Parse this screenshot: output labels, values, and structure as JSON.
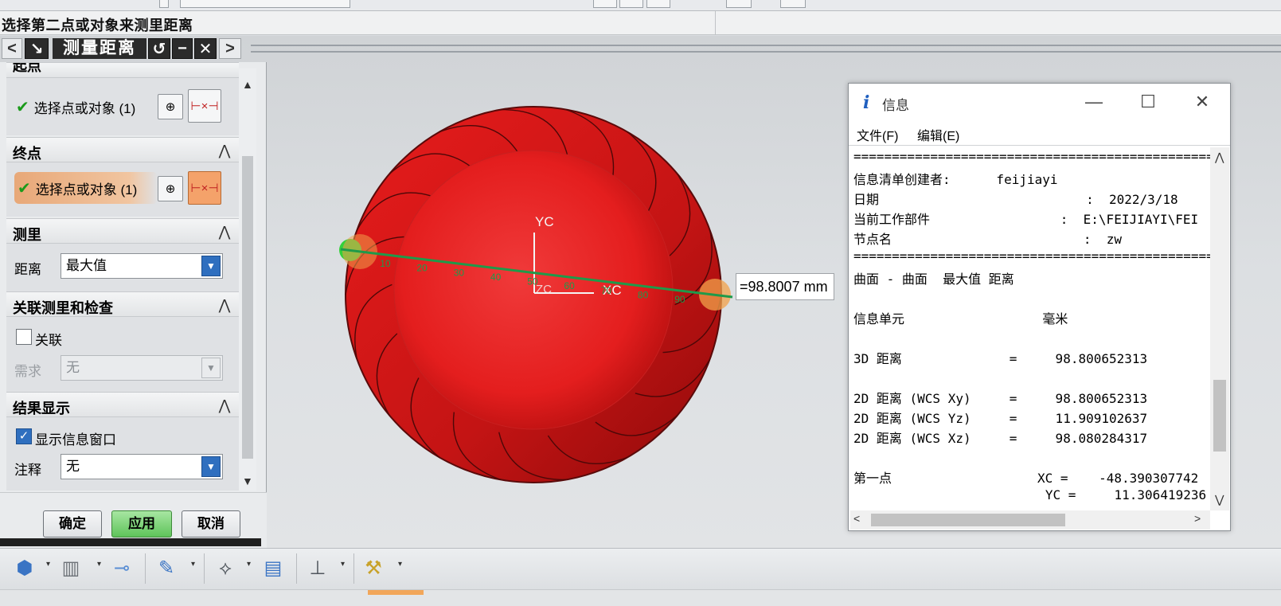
{
  "prompt": "选择第二点或对象来测里距离",
  "dialog": {
    "nav_prev": "<",
    "nav_next": ">",
    "title": "测量距离",
    "sections": {
      "start": {
        "label": "起点",
        "select_text": "选择点或对象 (1)"
      },
      "end": {
        "label": "终点",
        "select_text": "选择点或对象 (1)"
      },
      "measure": {
        "label": "测里",
        "distance_label": "距离",
        "distance_value": "最大值"
      },
      "assoc": {
        "label": "关联测里和检查",
        "assoc_label": "关联",
        "require_label": "需求",
        "require_value": "无"
      },
      "result": {
        "label": "结果显示",
        "show_info_label": "显示信息窗口",
        "note_label": "注释",
        "note_value": "无"
      }
    },
    "buttons": {
      "ok": "确定",
      "apply": "应用",
      "cancel": "取消"
    }
  },
  "viewport": {
    "axis_yc": "YC",
    "axis_xc": "XC",
    "axis_zc": "ZC",
    "ticks": [
      "10",
      "20",
      "30",
      "40",
      "50",
      "60",
      "70",
      "80",
      "90"
    ],
    "measure_result": "=98.8007 mm"
  },
  "info_window": {
    "title": "信息",
    "menu": {
      "file": "文件(F)",
      "edit": "编辑(E)"
    },
    "lines": [
      "================================================",
      "信息清单创建者:      feijiayi",
      "日期                           :  2022/3/18",
      "当前工作部件                 :  E:\\FEIJIAYI\\FEI",
      "节点名                         :  zw",
      "================================================",
      "曲面 - 曲面  最大值 距离",
      "",
      "信息单元                  毫米",
      "",
      "3D 距离              =     98.800652313",
      "",
      "2D 距离 (WCS Xy)     =     98.800652313",
      "2D 距离 (WCS Yz)     =     11.909102637",
      "2D 距离 (WCS Xz)     =     98.080284317",
      "",
      "第一点                   XC =    -48.390307742",
      "                         YC =     11.306419236"
    ]
  }
}
